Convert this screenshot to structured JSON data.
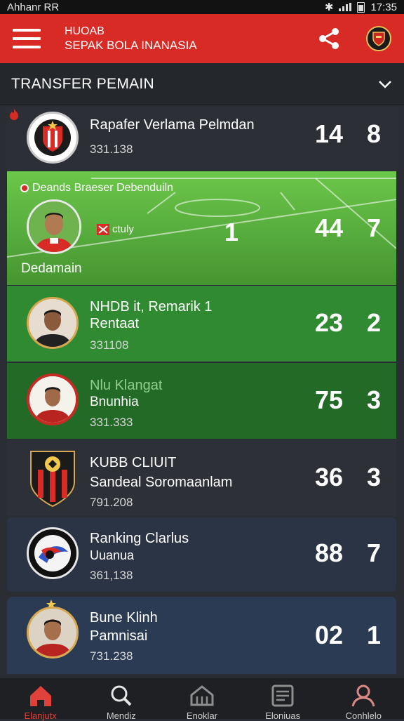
{
  "status_bar": {
    "left_text": "Ahhanr RR",
    "time": "17:35"
  },
  "app_bar": {
    "title_line1": "HUOAB",
    "title_line2": "SEPAK BOLA INANASIA"
  },
  "section": {
    "title": "TRANSFER PEMAIN"
  },
  "rows": [
    {
      "name": "Rapafer Verlama Pelmdan",
      "meta": "331.138",
      "num1": "14",
      "num2": "8"
    },
    {
      "header": "Deands Braeser Debenduiln",
      "tag": "ctuly",
      "name": "Dedamain",
      "num_mid": "1",
      "num1": "44",
      "num2": "7"
    },
    {
      "name": "NHDB it, Remarik 1",
      "name2": "Rentaat",
      "meta": "331108",
      "num1": "23",
      "num2": "2"
    },
    {
      "name": "Nlu Klangat",
      "name2": "Bnunhia",
      "meta": "331.333",
      "num1": "75",
      "num2": "3"
    },
    {
      "name": "KUBB CLIUIT",
      "name2": "Sandeal Soromaanlam",
      "meta": "791.208",
      "num1": "36",
      "num2": "3"
    },
    {
      "name": "Ranking Clarlus",
      "name2": "Uuanua",
      "meta": "361,138",
      "num1": "88",
      "num2": "7"
    },
    {
      "name": "Bune Klinh",
      "name2": "Pamnisai",
      "meta": "731.238",
      "num1": "02",
      "num2": "1"
    }
  ],
  "nav": [
    {
      "label": "Elanjutx",
      "icon": "home-icon",
      "active": true
    },
    {
      "label": "Mendiz",
      "icon": "search-icon"
    },
    {
      "label": "Enoklar",
      "icon": "stadium-icon"
    },
    {
      "label": "Eloniuas",
      "icon": "news-icon"
    },
    {
      "label": "Conhlelo",
      "icon": "profile-icon"
    }
  ],
  "colors": {
    "brand": "#d92b25",
    "pitch": "#5bb83d",
    "dark": "#2a2d33"
  }
}
